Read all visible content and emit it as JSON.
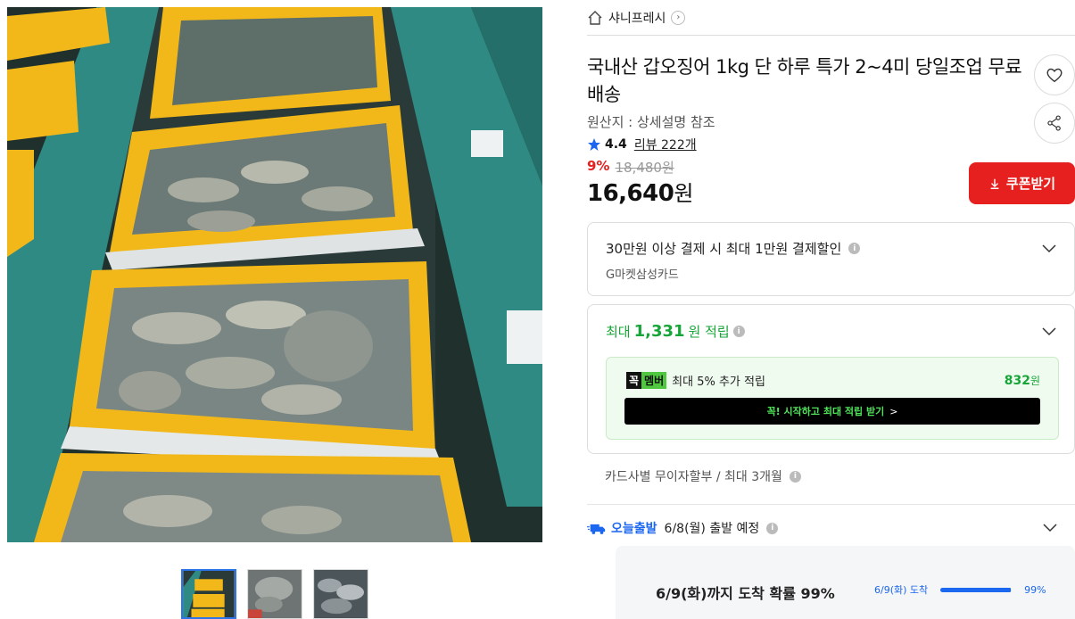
{
  "gallery": {
    "main_image": "squid-baskets-photo",
    "thumbnails": [
      "thumb-squid-baskets",
      "thumb-squid-closeup",
      "thumb-squid-pile"
    ],
    "active_thumbnail": 0
  },
  "shop": {
    "home_icon": "home-icon",
    "name": "샤니프레시"
  },
  "product": {
    "title": "국내산 갑오징어 1kg 단 하루 특가 2~4미 당일조업 무료배송",
    "origin": "원산지 : 상세설명 참조",
    "rating": "4.4",
    "review_text": "리뷰 222개",
    "discount_rate": "9%",
    "original_price": "18,480원",
    "price": "16,640",
    "price_unit": "원",
    "coupon_label": "쿠폰받기"
  },
  "card_discount": {
    "text": "30만원 이상 결제 시 최대 1만원 결제할인",
    "card": "G마켓삼성카드"
  },
  "points": {
    "prefix": "최대",
    "amount": "1,331",
    "suffix": "원 적립",
    "member_logo_a": "꼭",
    "member_logo_b": "멤버",
    "member_text": "최대 5% 추가 적립",
    "member_amount": "832",
    "member_amount_unit": "원",
    "member_cta": "꼭! 시작하고 최대 적립 받기",
    "member_cta_arrow": ">"
  },
  "installment": {
    "text": "카드사별 무이자할부 / 최대 3개월"
  },
  "shipping": {
    "badge": "오늘출발",
    "date": "6/8(월) 출발 예정",
    "arrival_text": "6/9(화)까지 도착 확률 99%",
    "arrival_small": "6/9(화) 도착",
    "arrival_percent_label": "99%",
    "arrival_fraction": 0.99
  },
  "colors": {
    "accent_red": "#e5201f",
    "points_green": "#16a538",
    "shipping_blue": "#1c67f0"
  }
}
